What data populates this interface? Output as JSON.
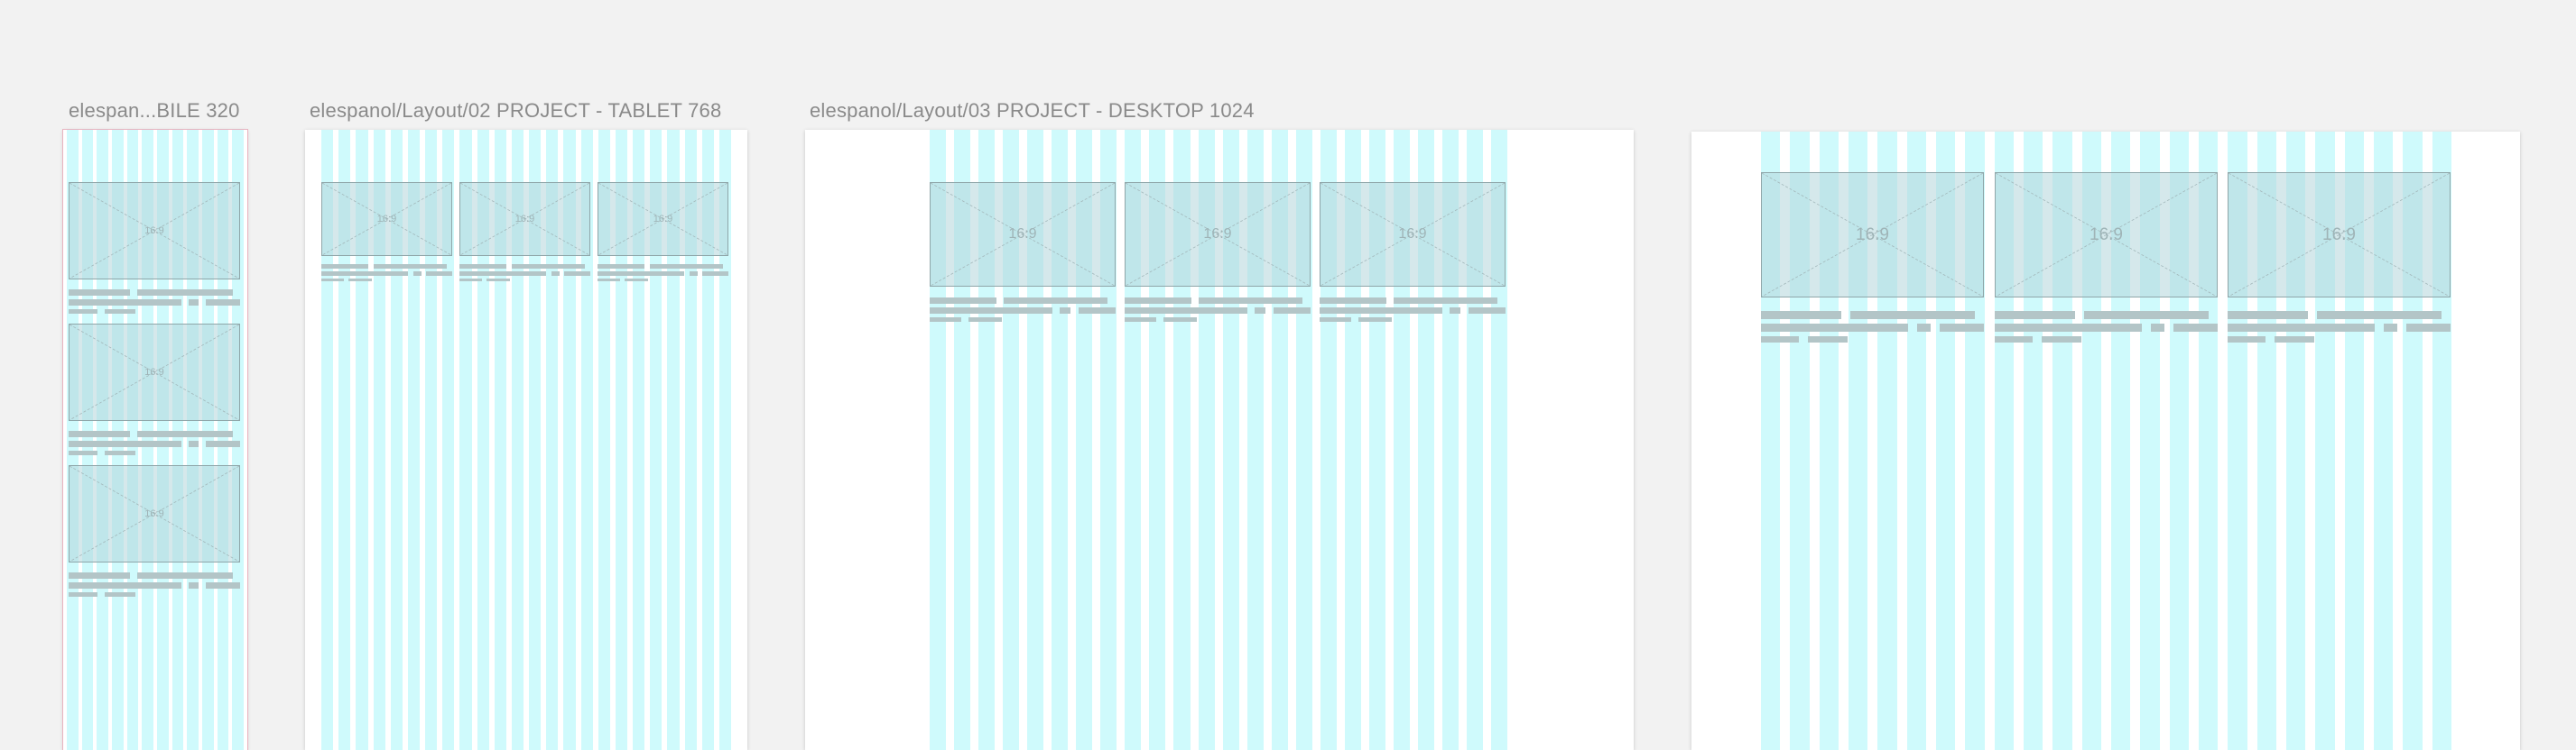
{
  "canvas": {
    "background": "#f2f2f2"
  },
  "colors": {
    "grid_column": "#cffafc",
    "image_placeholder_fill": "#b2d6da",
    "image_placeholder_stroke": "#8fa6a9",
    "text_skeleton": "#b3c5c7",
    "frame_label": "#8a8a8a"
  },
  "frames": [
    {
      "label": "elespan...BILE 320",
      "columns": 12,
      "cards": [
        {
          "ratio": "16:9"
        },
        {
          "ratio": "16:9"
        },
        {
          "ratio": "16:9"
        }
      ]
    },
    {
      "label": "elespanol/Layout/02 PROJECT - TABLET 768",
      "columns": 24,
      "cards": [
        {
          "ratio": "16:9"
        },
        {
          "ratio": "16:9"
        },
        {
          "ratio": "16:9"
        }
      ]
    },
    {
      "label": "elespanol/Layout/03 PROJECT - DESKTOP 1024",
      "columns": 24,
      "cards": [
        {
          "ratio": "16:9"
        },
        {
          "ratio": "16:9"
        },
        {
          "ratio": "16:9"
        }
      ]
    },
    {
      "label": "",
      "columns": 24,
      "cards": [
        {
          "ratio": "16:9"
        },
        {
          "ratio": "16:9"
        },
        {
          "ratio": "16:9"
        }
      ]
    }
  ]
}
